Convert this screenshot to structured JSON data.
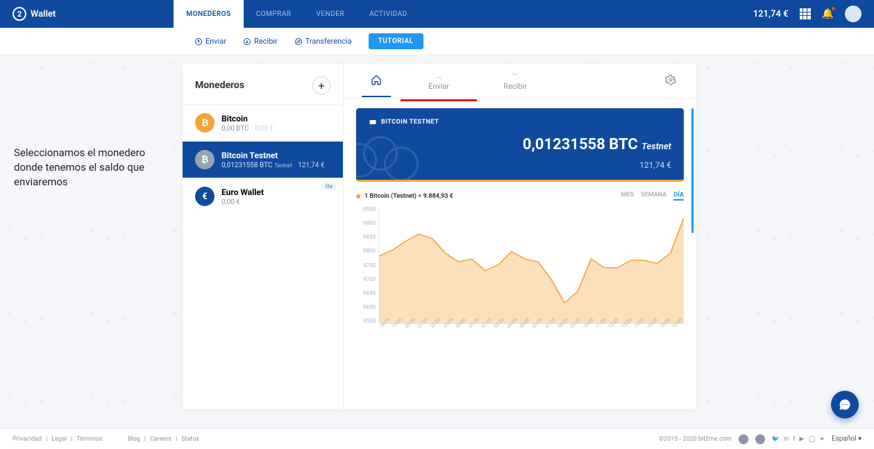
{
  "header": {
    "app_name": "Wallet",
    "nav": [
      "MONEDEROS",
      "COMPRAR",
      "VENDER",
      "ACTIVIDAD"
    ],
    "balance": "121,74 €"
  },
  "subnav": {
    "enviar": "Enviar",
    "recibir": "Recibir",
    "transferencia": "Transferencia",
    "tutorial": "TUTORIAL"
  },
  "annotation": "Seleccionamos el monedero donde tenemos el saldo que enviaremos",
  "wallets": {
    "title": "Monederos",
    "items": [
      {
        "name": "Bitcoin",
        "amount": "0,00 BTC",
        "eur": "0,00 €",
        "icon": "₿",
        "cls": "btc"
      },
      {
        "name": "Bitcoin Testnet",
        "amount": "0,01231558 BTC",
        "testnet": "Testnet",
        "eur": "121,74 €",
        "icon": "₿",
        "cls": "btct",
        "selected": true
      },
      {
        "name": "Euro Wallet",
        "amount": "0,00 €",
        "eur": "",
        "icon": "€",
        "cls": "eur",
        "lite": "lite"
      }
    ]
  },
  "detail": {
    "tabs": {
      "enviar": "Enviar",
      "recibir": "Recibir"
    },
    "card": {
      "title": "BITCOIN TESTNET",
      "amount": "0,01231558 BTC",
      "testnet": "Testnet",
      "eur": "121,74 €"
    },
    "chart_label": "1 Bitcoin (Testnet) = 9.884,93 €",
    "ranges": {
      "mes": "MES",
      "semana": "SEMANA",
      "dia": "DÍA"
    }
  },
  "chart_data": {
    "type": "area",
    "title": "",
    "ylabel": "",
    "ylim": [
      9550,
      9950
    ],
    "y_ticks": [
      "9950",
      "9900",
      "9850",
      "9800",
      "9750",
      "9700",
      "9650",
      "9600",
      "9550"
    ],
    "x_ticks": [
      "18:05",
      "19:05",
      "20:05",
      "21:05",
      "22:05",
      "23:05",
      "00:05",
      "01:05",
      "02:05",
      "03:05",
      "04:05",
      "05:05",
      "06:05",
      "07:05",
      "08:05",
      "09:05",
      "10:05",
      "11:05",
      "12:05",
      "13:05",
      "14:05",
      "15:05",
      "16:05",
      "17:05"
    ],
    "values": [
      9780,
      9800,
      9830,
      9855,
      9840,
      9790,
      9760,
      9770,
      9730,
      9750,
      9795,
      9770,
      9760,
      9700,
      9620,
      9660,
      9770,
      9740,
      9740,
      9765,
      9765,
      9755,
      9790,
      9910
    ]
  },
  "footer": {
    "links_left": [
      "Privacidad",
      "Legal",
      "Términos"
    ],
    "links_mid": [
      "Blog",
      "Careers",
      "Status"
    ],
    "copyright": "©2015 - 2020  bit2me.com",
    "lang": "Español ▾"
  }
}
